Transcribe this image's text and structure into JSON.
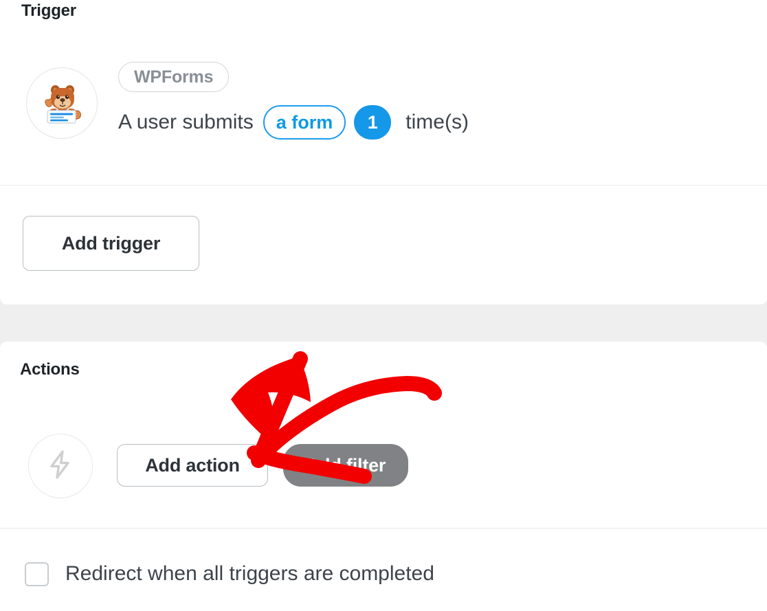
{
  "sections": {
    "trigger": {
      "title": "Trigger",
      "provider_badge": "WPForms",
      "avatar_icon": "wpforms-mascot-icon",
      "sentence": {
        "lead": "A user submits",
        "object_pill": "a form",
        "count_badge": "1",
        "tail": "time(s)"
      },
      "add_trigger_label": "Add trigger"
    },
    "actions": {
      "title": "Actions",
      "avatar_icon": "lightning-bolt-icon",
      "add_action_label": "Add action",
      "add_filter_label": "Add filter"
    },
    "footer": {
      "redirect_checkbox_label": "Redirect when all triggers are completed",
      "redirect_checked": false
    }
  },
  "annotation": {
    "type": "hand-drawn-arrow",
    "points_to": "Add action",
    "color": "#f20000"
  },
  "colors": {
    "accent_blue": "#1598e8",
    "pill_blue_border": "#1d9bf0",
    "grey_button": "#808285",
    "panel_background": "#ffffff",
    "page_background": "#efefef",
    "divider": "#e8e8e8",
    "annotation_red": "#f20000"
  }
}
